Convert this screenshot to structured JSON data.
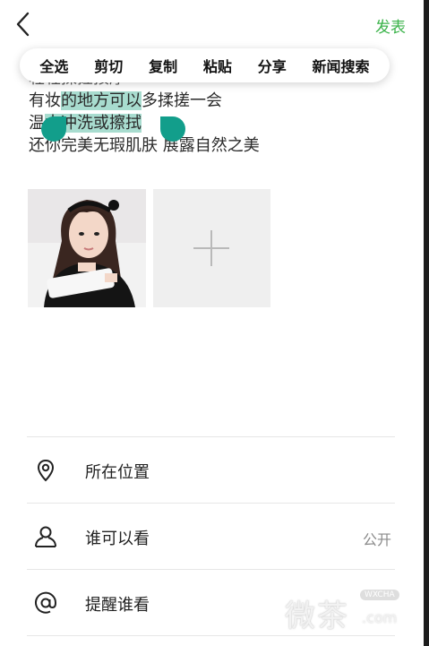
{
  "header": {
    "back_icon": "chevron-left-icon",
    "publish_label": "发表",
    "accent_color": "#3bb34a"
  },
  "context_menu": {
    "items": [
      "全选",
      "剪切",
      "复制",
      "粘贴",
      "分享",
      "新闻搜索"
    ]
  },
  "post_text": {
    "partial_line": "轻轻揉搓按摩",
    "line2": {
      "before": "有妆",
      "selected": "的地方可以",
      "after": "多揉搓一会"
    },
    "line3": {
      "before": "温",
      "selected": "水冲洗或擦拭",
      "after": ""
    },
    "line4": "还你完美无瑕肌肤 展露自然之美",
    "selection_color": "#a8dccf",
    "handle_color": "#129e8b"
  },
  "media": {
    "photo_alt": "照片",
    "add_icon": "plus-icon"
  },
  "options": [
    {
      "icon": "location-pin-icon",
      "label": "所在位置",
      "value": ""
    },
    {
      "icon": "person-icon",
      "label": "谁可以看",
      "value": "公开"
    },
    {
      "icon": "at-icon",
      "label": "提醒谁看",
      "value": ""
    }
  ],
  "watermark": {
    "text": "微茶",
    "badge": "WXCHA",
    "domain": ".com"
  }
}
